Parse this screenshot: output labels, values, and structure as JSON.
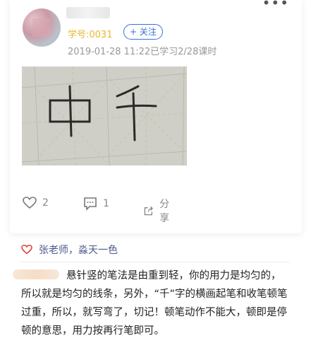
{
  "post": {
    "student_id": "学号:0031",
    "follow_label": "+ 关注",
    "meta": "2019-01-28 11:22已学习2/28课时",
    "more_icon": "more-dots-icon",
    "likes_count": "2",
    "comments_count": "1",
    "share_label": "分享"
  },
  "liked_by": {
    "text": "张老师，淼天一色",
    "icon": "heart-icon",
    "color": "#e0413d"
  },
  "comment": {
    "text": "悬针竖的笔法是由重到轻，你的用力是均匀的，所以就是均匀的线条，另外，“千”字的横画起笔和收笔顿笔过重，所以，就写弯了，切记！顿笔动作不能大，顿即是停顿的意思，用力按再行笔即可。"
  },
  "colors": {
    "accent_blue": "#3b6edb",
    "student_id": "#e8b92d",
    "meta_gray": "#999999"
  }
}
